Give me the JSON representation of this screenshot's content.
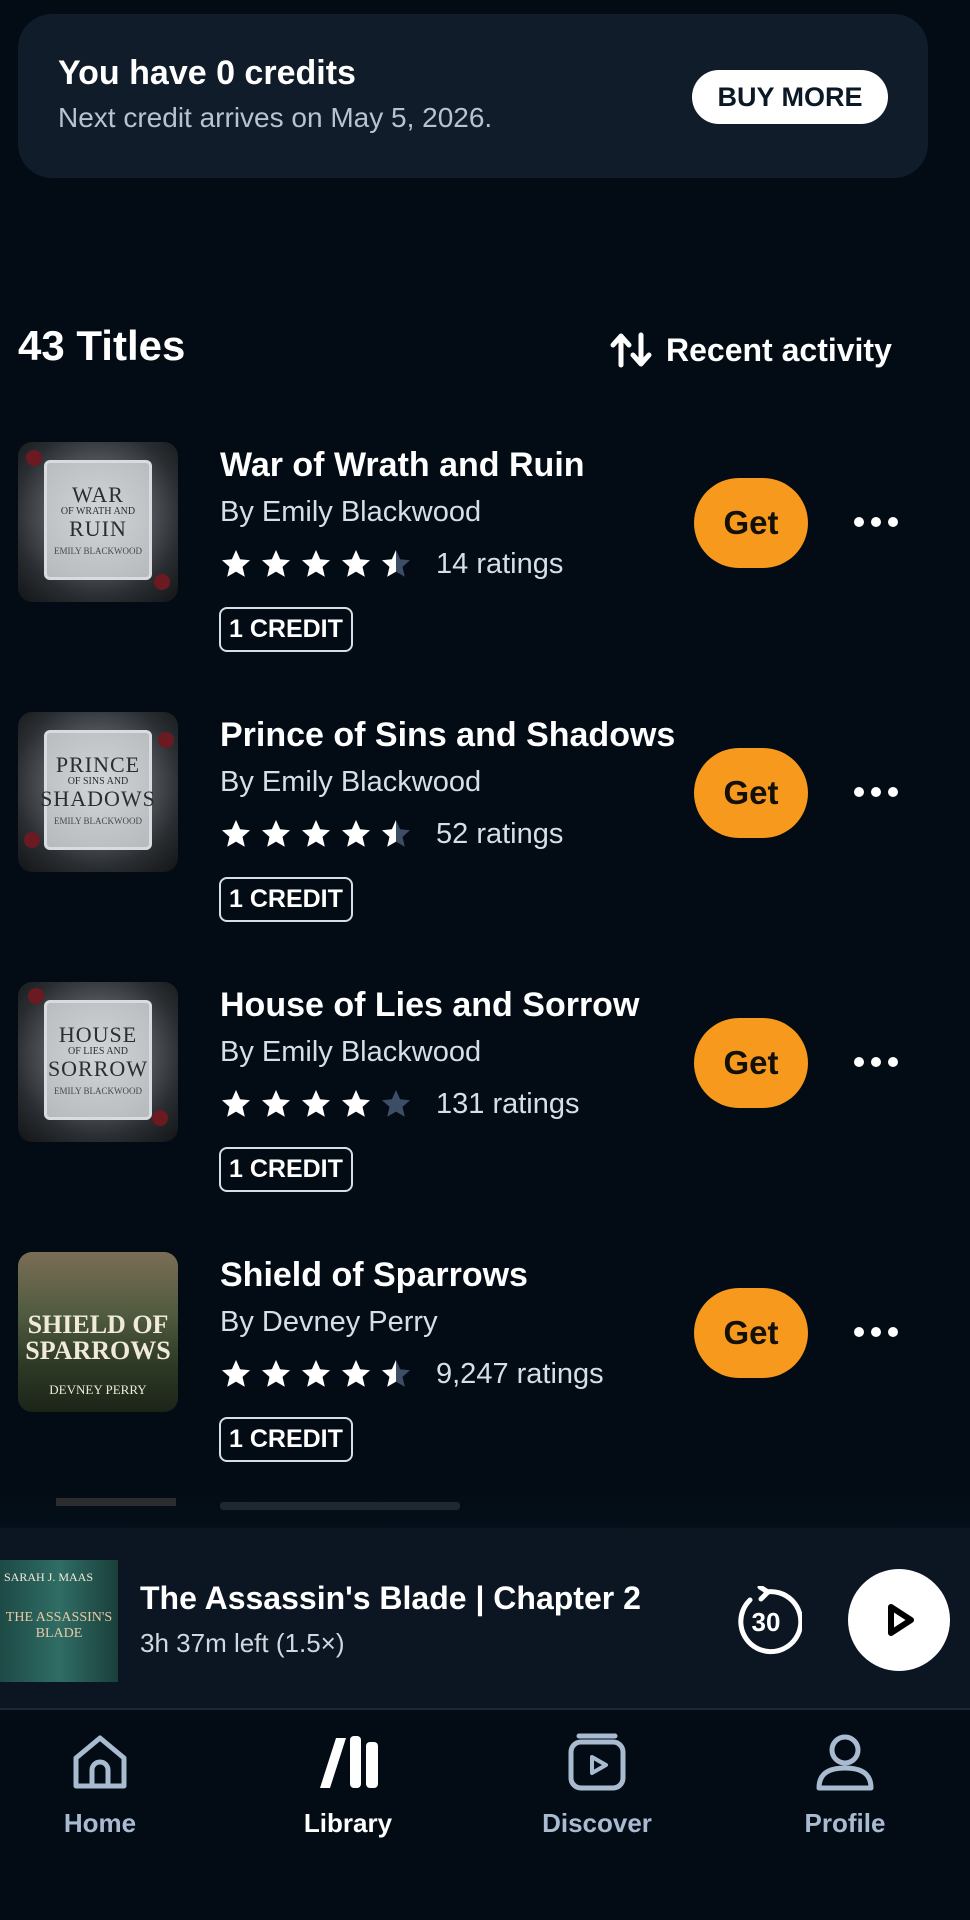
{
  "credits": {
    "title": "You have 0 credits",
    "subtitle": "Next credit arrives on May 5, 2026.",
    "buy_more": "BUY MORE"
  },
  "library": {
    "count_label": "43 Titles",
    "sort_label": "Recent activity"
  },
  "books": [
    {
      "title": "War of Wrath and Ruin",
      "author": "By Emily Blackwood",
      "rating": 4.5,
      "ratings_label": "14 ratings",
      "credit": "1 CREDIT",
      "get": "Get",
      "cover_title": "WAR",
      "cover_mid": "OF WRATH AND",
      "cover_end": "RUIN",
      "cover_author": "EMILY BLACKWOOD"
    },
    {
      "title": "Prince of Sins and Shadows",
      "author": "By Emily Blackwood",
      "rating": 4.5,
      "ratings_label": "52 ratings",
      "credit": "1 CREDIT",
      "get": "Get",
      "cover_title": "PRINCE",
      "cover_mid": "OF SINS AND",
      "cover_end": "SHADOWS",
      "cover_author": "EMILY BLACKWOOD"
    },
    {
      "title": "House of Lies and Sorrow",
      "author": "By Emily Blackwood",
      "rating": 4,
      "ratings_label": "131 ratings",
      "credit": "1 CREDIT",
      "get": "Get",
      "cover_title": "HOUSE",
      "cover_mid": "OF LIES AND",
      "cover_end": "SORROW",
      "cover_author": "EMILY BLACKWOOD"
    },
    {
      "title": "Shield of Sparrows",
      "author": "By Devney Perry",
      "rating": 4.5,
      "ratings_label": "9,247 ratings",
      "credit": "1 CREDIT",
      "get": "Get",
      "cover_title": "SHIELD OF SPARROWS",
      "cover_author": "DEVNEY PERRY"
    }
  ],
  "player": {
    "title": "The Assassin's Blade | Chapter 2",
    "subtitle": "3h 37m left (1.5×)",
    "skip_label": "30",
    "cover_author": "SARAH J. MAAS",
    "cover_title": "THE ASSASSIN'S BLADE"
  },
  "nav": {
    "home": "Home",
    "library": "Library",
    "discover": "Discover",
    "profile": "Profile"
  },
  "colors": {
    "background": "#030c14",
    "accent_get": "#f7991c",
    "card": "#101c2a",
    "nav_inactive": "#a9bbd0"
  }
}
